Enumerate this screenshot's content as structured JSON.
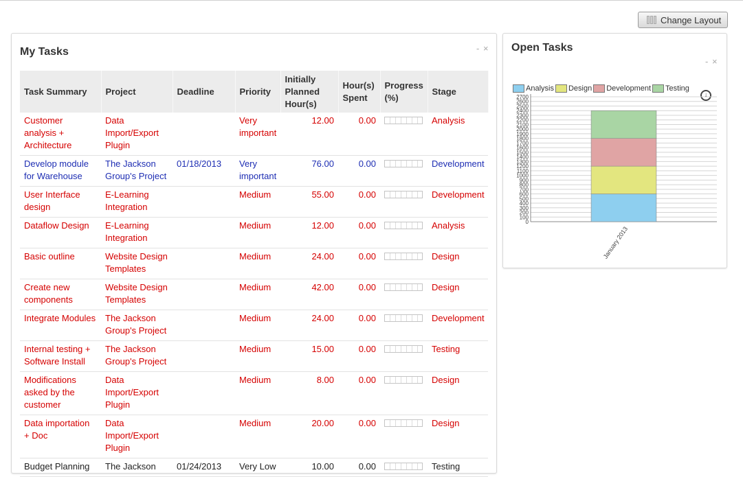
{
  "toolbar": {
    "change_layout_label": "Change Layout"
  },
  "my_tasks": {
    "title": "My Tasks",
    "controls": "- ×",
    "columns": [
      "Task Summary",
      "Project",
      "Deadline",
      "Priority",
      "Initially Planned Hour(s)",
      "Hour(s) Spent",
      "Progress (%)",
      "Stage"
    ],
    "rows": [
      {
        "summary": "Customer analysis + Architecture",
        "project": "Data Import/Export Plugin",
        "deadline": "",
        "priority": "Very important",
        "planned": "12.00",
        "spent": "0.00",
        "progress": 0,
        "stage": "Analysis",
        "color": "red"
      },
      {
        "summary": "Develop module for Warehouse",
        "project": "The Jackson Group's Project",
        "deadline": "01/18/2013",
        "priority": "Very important",
        "planned": "76.00",
        "spent": "0.00",
        "progress": 0,
        "stage": "Development",
        "color": "blue"
      },
      {
        "summary": "User Interface design",
        "project": "E-Learning Integration",
        "deadline": "",
        "priority": "Medium",
        "planned": "55.00",
        "spent": "0.00",
        "progress": 0,
        "stage": "Development",
        "color": "red"
      },
      {
        "summary": "Dataflow Design",
        "project": "E-Learning Integration",
        "deadline": "",
        "priority": "Medium",
        "planned": "12.00",
        "spent": "0.00",
        "progress": 0,
        "stage": "Analysis",
        "color": "red"
      },
      {
        "summary": "Basic outline",
        "project": "Website Design Templates",
        "deadline": "",
        "priority": "Medium",
        "planned": "24.00",
        "spent": "0.00",
        "progress": 0,
        "stage": "Design",
        "color": "red"
      },
      {
        "summary": "Create new components",
        "project": "Website Design Templates",
        "deadline": "",
        "priority": "Medium",
        "planned": "42.00",
        "spent": "0.00",
        "progress": 0,
        "stage": "Design",
        "color": "red"
      },
      {
        "summary": "Integrate Modules",
        "project": "The Jackson Group's Project",
        "deadline": "",
        "priority": "Medium",
        "planned": "24.00",
        "spent": "0.00",
        "progress": 0,
        "stage": "Development",
        "color": "red"
      },
      {
        "summary": "Internal testing + Software Install",
        "project": "The Jackson Group's Project",
        "deadline": "",
        "priority": "Medium",
        "planned": "15.00",
        "spent": "0.00",
        "progress": 0,
        "stage": "Testing",
        "color": "red"
      },
      {
        "summary": "Modifications asked by the customer",
        "project": "Data Import/Export Plugin",
        "deadline": "",
        "priority": "Medium",
        "planned": "8.00",
        "spent": "0.00",
        "progress": 0,
        "stage": "Design",
        "color": "red"
      },
      {
        "summary": "Data importation + Doc",
        "project": "Data Import/Export Plugin",
        "deadline": "",
        "priority": "Medium",
        "planned": "20.00",
        "spent": "0.00",
        "progress": 0,
        "stage": "Design",
        "color": "red"
      },
      {
        "summary": "Budget Planning",
        "project": "The Jackson",
        "deadline": "01/24/2013",
        "priority": "Very Low",
        "planned": "10.00",
        "spent": "0.00",
        "progress": 0,
        "stage": "Testing",
        "color": "black"
      }
    ]
  },
  "open_tasks": {
    "title": "Open Tasks",
    "controls": "- ×",
    "download_icon": "download-circle-icon",
    "chart_data": {
      "type": "bar",
      "stacked": true,
      "categories": [
        "January 2013"
      ],
      "series": [
        {
          "name": "Analysis",
          "values": [
            600
          ],
          "color": "#8ecfef"
        },
        {
          "name": "Design",
          "values": [
            600
          ],
          "color": "#e3e67f"
        },
        {
          "name": "Development",
          "values": [
            600
          ],
          "color": "#e0a4a4"
        },
        {
          "name": "Testing",
          "values": [
            600
          ],
          "color": "#a9d5a4"
        }
      ],
      "ylim": [
        0,
        2700
      ],
      "yticks": [
        0,
        100,
        200,
        300,
        400,
        500,
        600,
        700,
        800,
        900,
        1000,
        1100,
        1200,
        1300,
        1400,
        1500,
        1600,
        1700,
        1800,
        1900,
        2000,
        2100,
        2200,
        2300,
        2400,
        2500,
        2600,
        2700
      ],
      "grid": true,
      "legend": "top-left",
      "title": "",
      "xlabel": "",
      "ylabel": ""
    }
  }
}
